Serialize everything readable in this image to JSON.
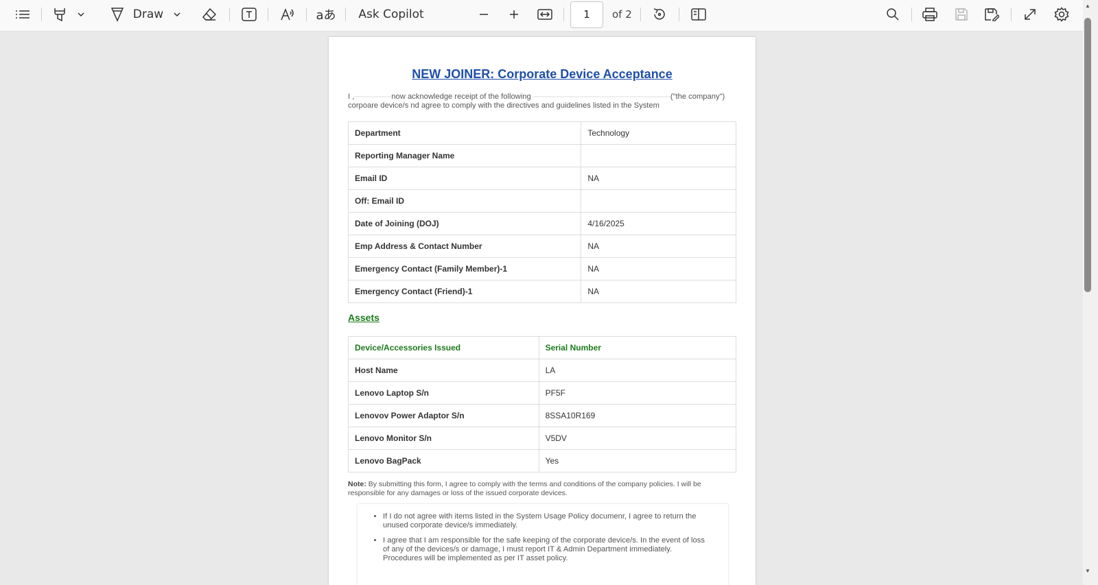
{
  "toolbar": {
    "draw_label": "Draw",
    "ask_copilot_label": "Ask Copilot",
    "current_page": "1",
    "page_total_label": "of 2"
  },
  "document": {
    "title": "NEW JOINER: Corporate Device Acceptance",
    "intro_part1": "I ,",
    "intro_part2": "now acknowledge receipt of the following",
    "intro_part3": "(\"the company\") corpoare device/s nd agree to comply with the directives and guidelines listed in the System",
    "info_rows": [
      {
        "key": "Department",
        "value": "Technology"
      },
      {
        "key": "Reporting Manager Name",
        "value": ""
      },
      {
        "key": "Email ID",
        "value": "NA"
      },
      {
        "key": "Off: Email ID",
        "value": ""
      },
      {
        "key": "Date of Joining (DOJ)",
        "value": "4/16/2025"
      },
      {
        "key": "Emp Address & Contact Number",
        "value": "NA"
      },
      {
        "key": "Emergency Contact (Family Member)-1",
        "value": "NA"
      },
      {
        "key": "Emergency Contact (Friend)-1",
        "value": "NA"
      }
    ],
    "assets_title": "Assets",
    "assets_header": {
      "device": "Device/Accessories Issued",
      "serial": "Serial Number"
    },
    "asset_rows": [
      {
        "device": "Host Name",
        "serial": "LA"
      },
      {
        "device": "Lenovo Laptop S/n",
        "serial": "PF5F"
      },
      {
        "device": "Lenovov Power Adaptor S/n",
        "serial": "8SSA10R169"
      },
      {
        "device": "Lenovo Monitor S/n",
        "serial": "V5DV"
      },
      {
        "device": "Lenovo BagPack",
        "serial": "Yes"
      }
    ],
    "note_label": "Note:",
    "note_text": " By submitting this form, I agree to comply with the terms and conditions of the company policies. I will be responsible for any damages or loss of the issued corporate devices.",
    "bullets": [
      "If I do not agree with items listed in the System Usage Policy documenr, I agree to return the unused corporate device/s immediately.",
      "I agree that I am responsible for the safe keeping of the corporate device/s. In the event of loss of any of the devices/s or damage, I must report IT & Admin Department immediately. Procedures will be implemented as per IT asset policy."
    ]
  }
}
